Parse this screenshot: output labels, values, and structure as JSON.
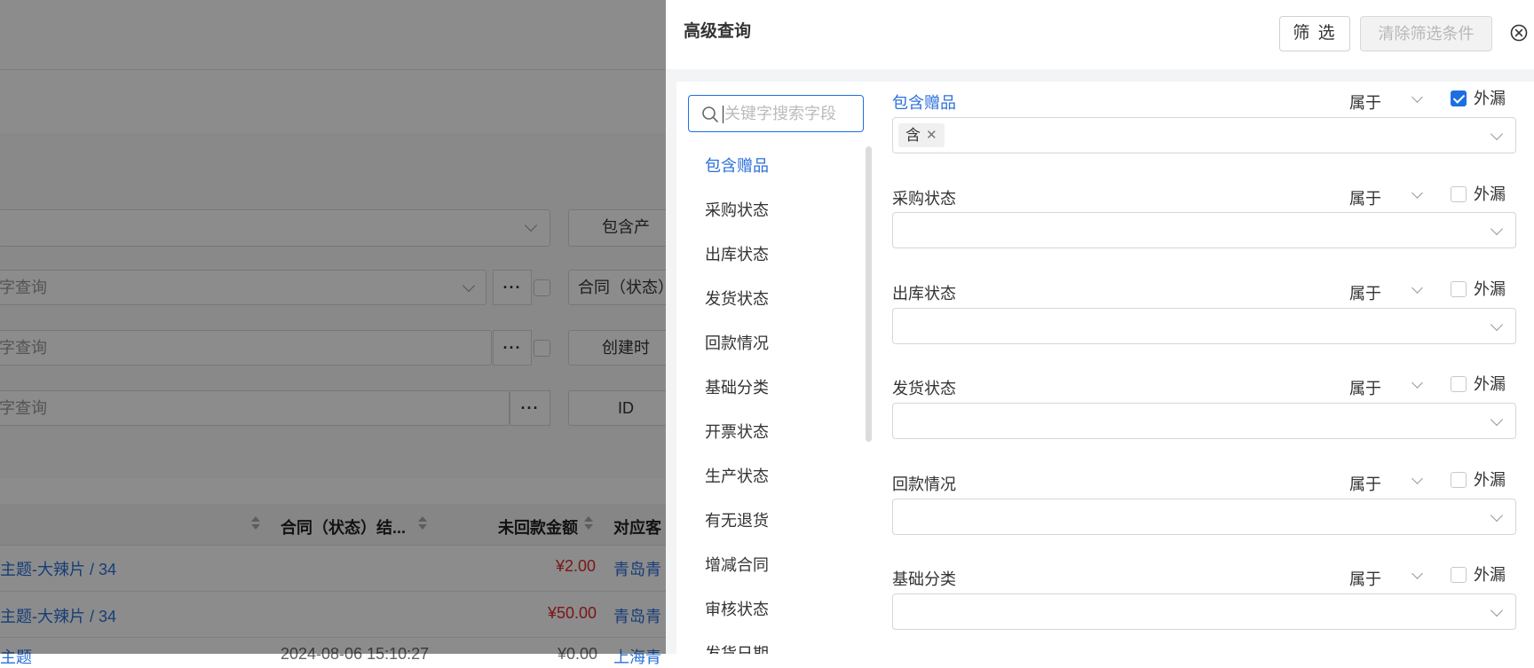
{
  "background": {
    "search_placeholder": "字查询",
    "filter_buttons": [
      "包含产",
      "合同（状态）",
      "创建时",
      "ID"
    ],
    "more_label": "···",
    "table": {
      "headers": [
        "合同（状态）结...",
        "未回款金额",
        "对应客"
      ],
      "rows": [
        {
          "subject": "主题-大辣片 / 34",
          "amount": "¥2.00",
          "customer": "青岛青"
        },
        {
          "subject": "主题-大辣片 / 34",
          "amount": "¥50.00",
          "customer": "青岛青"
        },
        {
          "subject": "主题",
          "date": "2024-08-06 15:10:27",
          "amount": "¥0.00",
          "customer": "上海青"
        }
      ]
    }
  },
  "drawer": {
    "title": "高级查询",
    "filter_button": "筛 选",
    "clear_button": "清除筛选条件",
    "search_placeholder": "关键字搜索字段",
    "field_list": [
      "包含赠品",
      "采购状态",
      "出库状态",
      "发货状态",
      "回款情况",
      "基础分类",
      "开票状态",
      "生产状态",
      "有无退货",
      "增减合同",
      "审核状态",
      "发货日期"
    ],
    "active_field": "包含赠品",
    "filters": [
      {
        "label": "包含赠品",
        "operator": "属于",
        "exclude_label": "外漏",
        "exclude_checked": true,
        "tags": [
          "含"
        ]
      },
      {
        "label": "采购状态",
        "operator": "属于",
        "exclude_label": "外漏",
        "exclude_checked": false,
        "tags": []
      },
      {
        "label": "出库状态",
        "operator": "属于",
        "exclude_label": "外漏",
        "exclude_checked": false,
        "tags": []
      },
      {
        "label": "发货状态",
        "operator": "属于",
        "exclude_label": "外漏",
        "exclude_checked": false,
        "tags": []
      },
      {
        "label": "回款情况",
        "operator": "属于",
        "exclude_label": "外漏",
        "exclude_checked": false,
        "tags": []
      },
      {
        "label": "基础分类",
        "operator": "属于",
        "exclude_label": "外漏",
        "exclude_checked": false,
        "tags": []
      }
    ],
    "accent_color": "#1d6fe0"
  }
}
